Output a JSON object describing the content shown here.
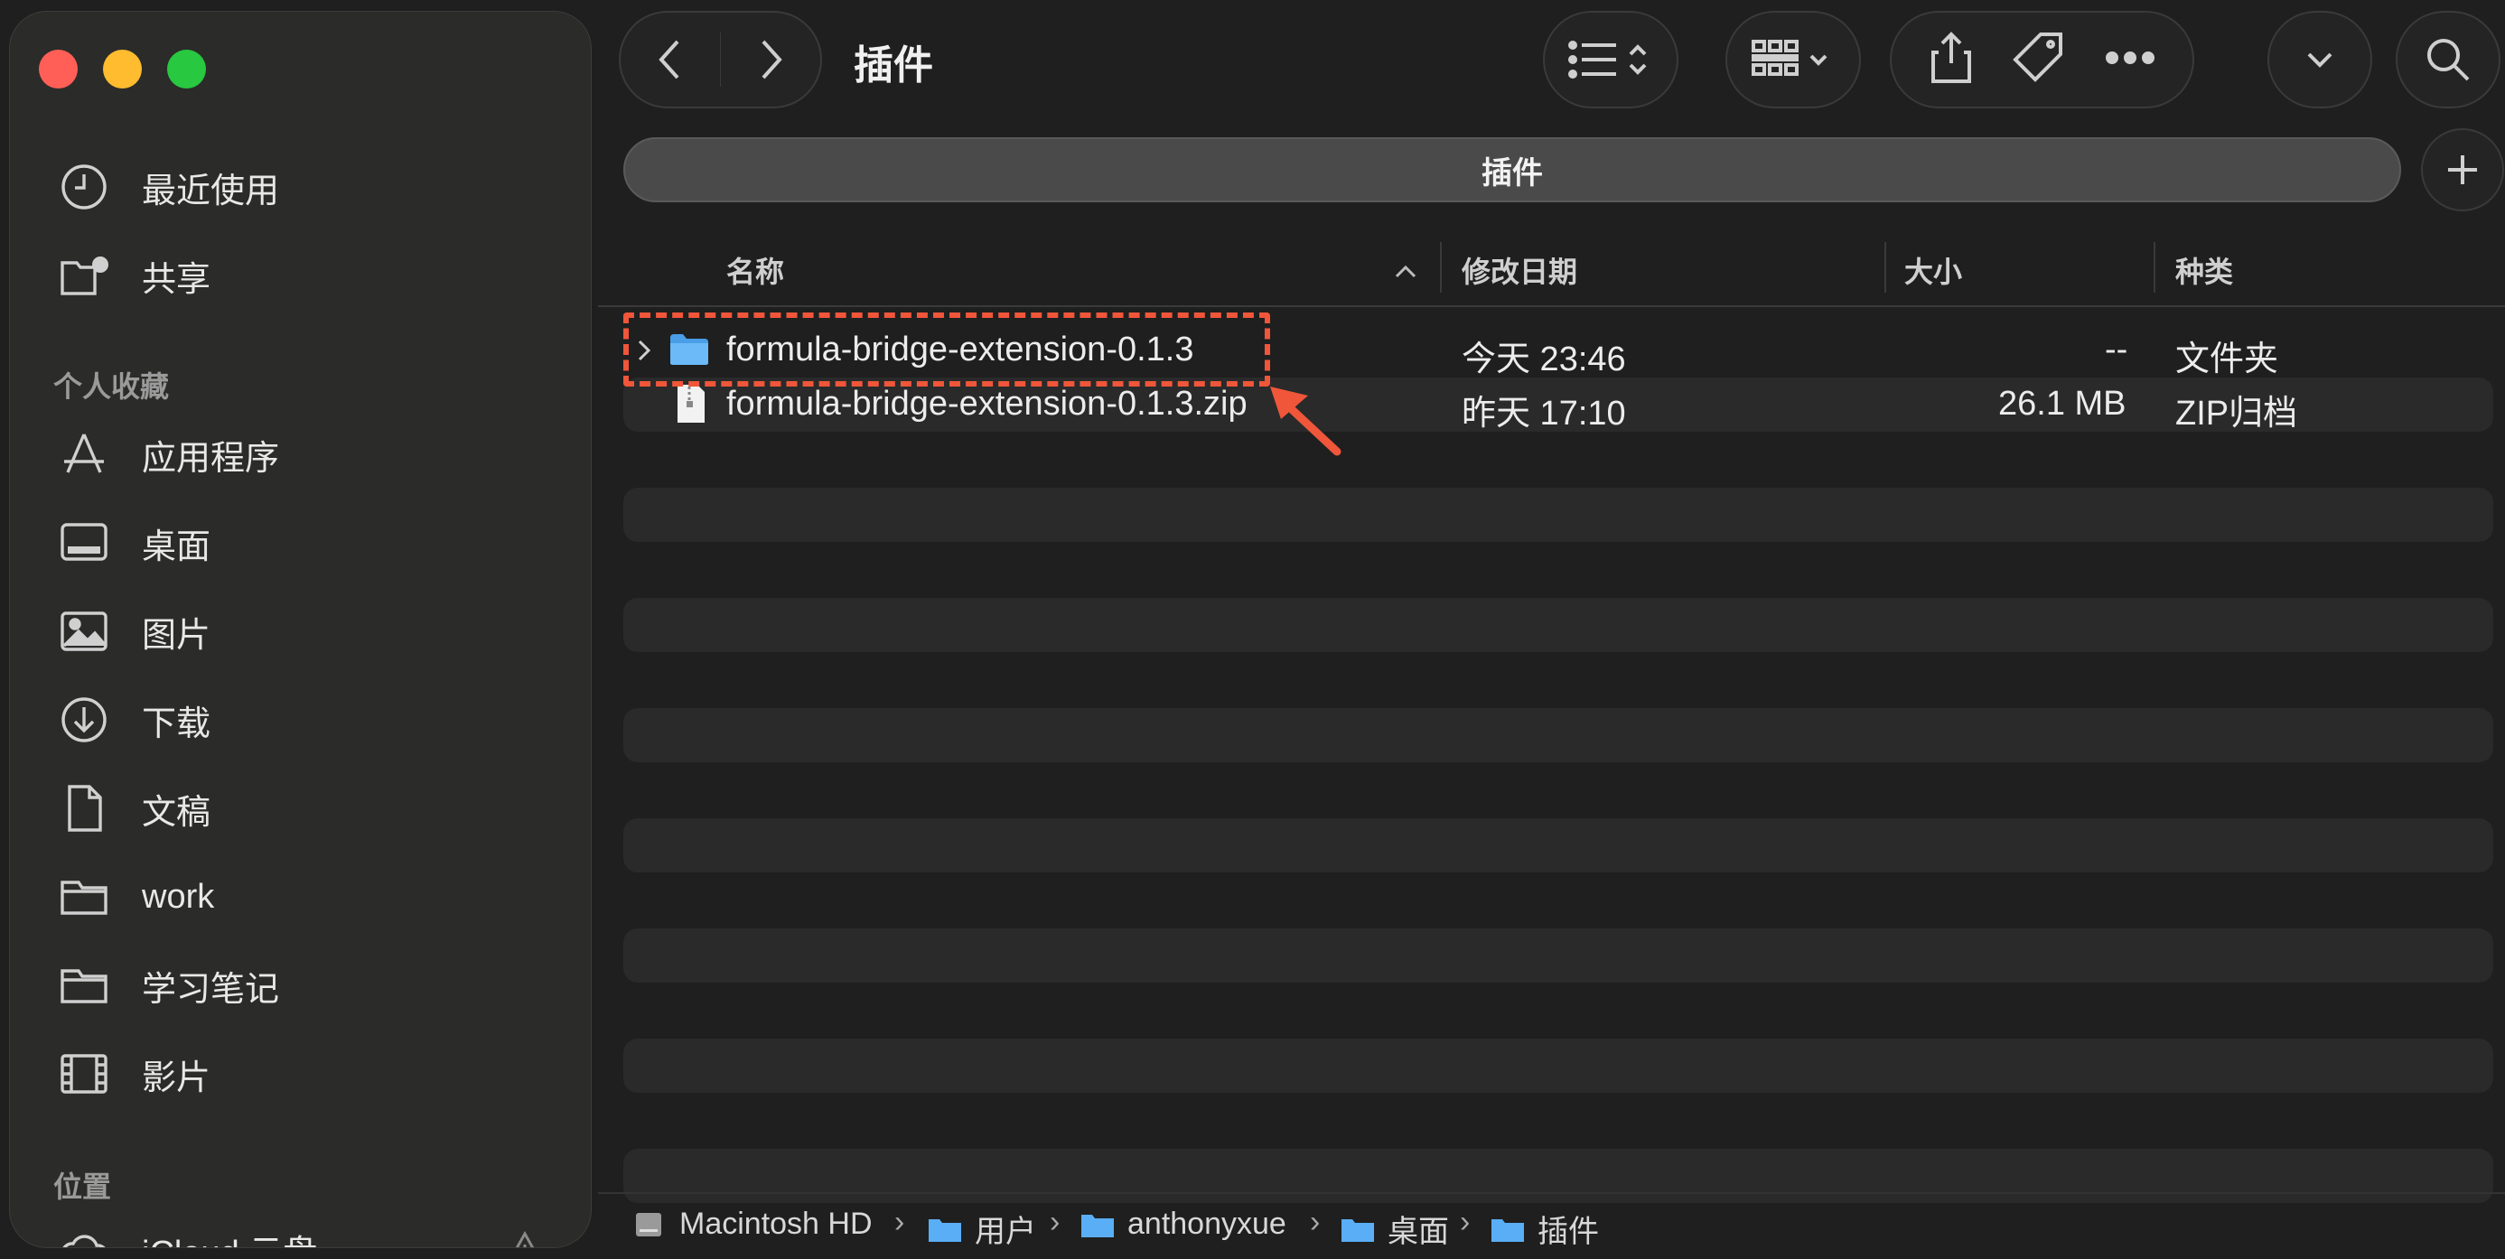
{
  "window": {
    "title": "插件"
  },
  "sidebar": {
    "items_top": [
      {
        "label": "最近使用",
        "icon": "clock-icon"
      },
      {
        "label": "共享",
        "icon": "shared-folder-icon"
      }
    ],
    "favorites_header": "个人收藏",
    "favorites": [
      {
        "label": "应用程序",
        "icon": "applications-icon"
      },
      {
        "label": "桌面",
        "icon": "desktop-icon"
      },
      {
        "label": "图片",
        "icon": "pictures-icon"
      },
      {
        "label": "下载",
        "icon": "download-icon"
      },
      {
        "label": "文稿",
        "icon": "document-icon"
      },
      {
        "label": "work",
        "icon": "folder-icon"
      },
      {
        "label": "学习笔记",
        "icon": "folder-icon"
      },
      {
        "label": "影片",
        "icon": "film-icon"
      }
    ],
    "locations_header": "位置",
    "locations": [
      {
        "label": "iCloud 云盘",
        "icon": "cloud-icon"
      }
    ]
  },
  "tabbar": {
    "active_tab": "插件"
  },
  "columns": {
    "name": "名称",
    "date": "修改日期",
    "size": "大小",
    "kind": "种类"
  },
  "files": [
    {
      "name": "formula-bridge-extension-0.1.3",
      "date": "今天 23:46",
      "size": "--",
      "kind": "文件夹",
      "type": "folder"
    },
    {
      "name": "formula-bridge-extension-0.1.3.zip",
      "date": "昨天 17:10",
      "size": "26.1 MB",
      "kind": "ZIP归档",
      "type": "zip"
    }
  ],
  "pathbar": [
    "Macintosh HD",
    "用户",
    "anthonyxue",
    "桌面",
    "插件"
  ],
  "colors": {
    "annotation": "#f0563a",
    "folder": "#5aaef5"
  }
}
